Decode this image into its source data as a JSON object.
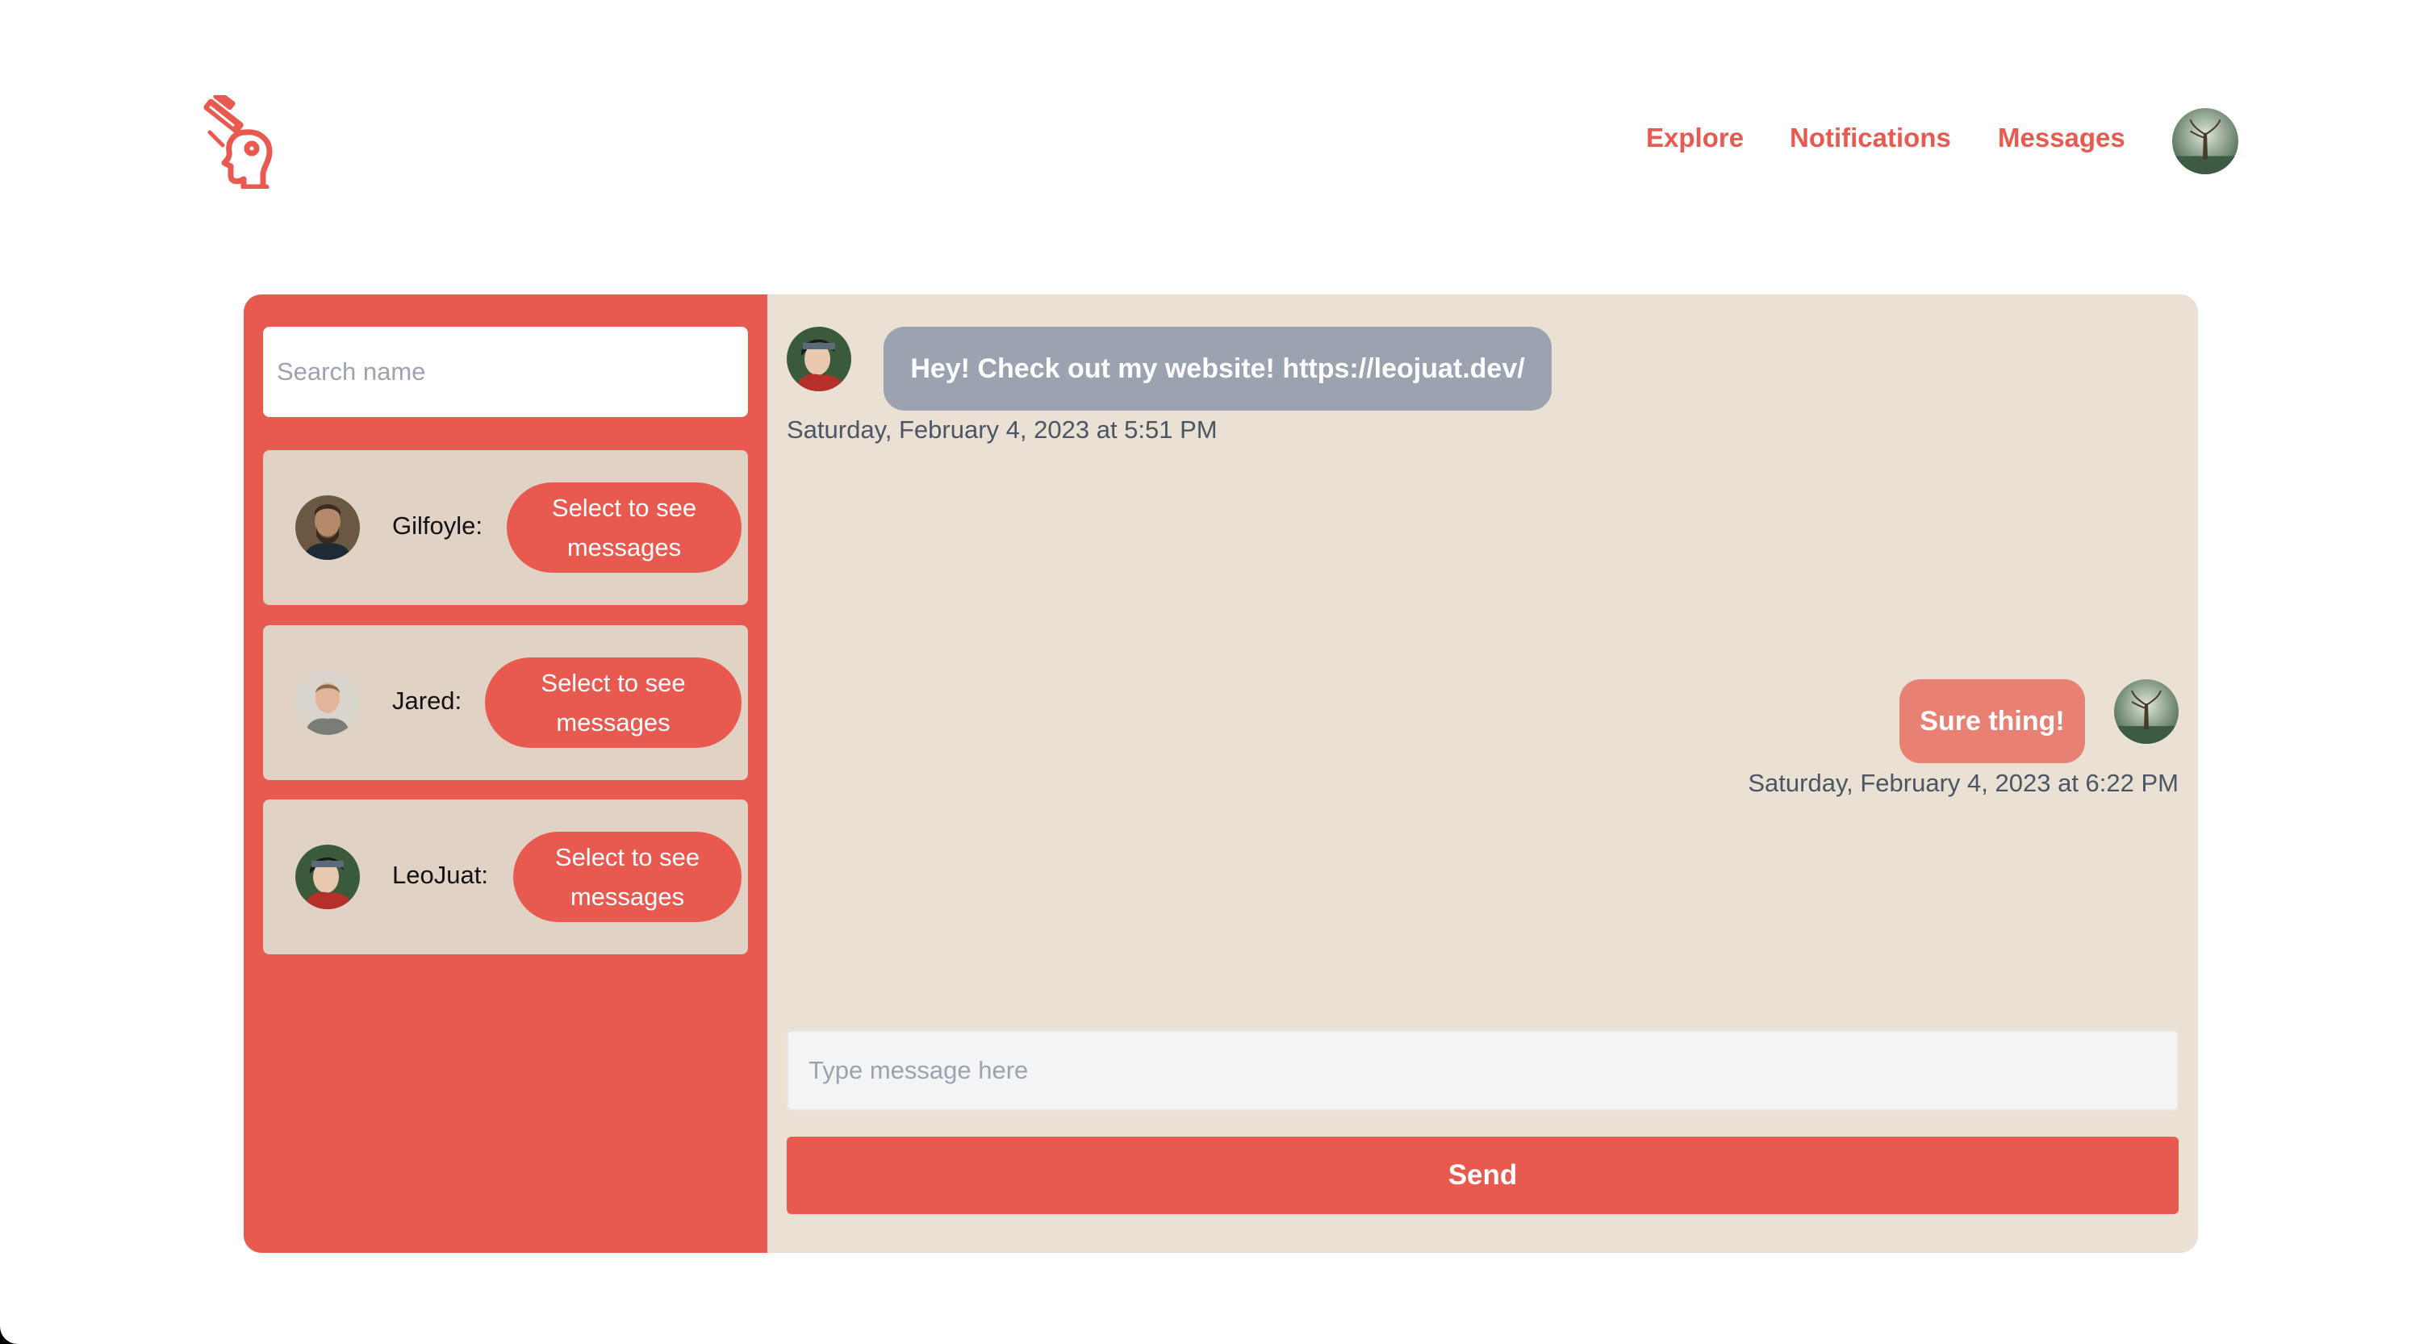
{
  "header": {
    "logo_icon": "brain-head-logo-icon",
    "nav": [
      {
        "label": "Explore"
      },
      {
        "label": "Notifications"
      },
      {
        "label": "Messages"
      }
    ],
    "profile_avatar": "user-avatar"
  },
  "colors": {
    "accent": "#e85a4f",
    "panel_background": "#eae0d4",
    "card_background": "#e0d3c6",
    "received_bubble": "#9aa3af",
    "sent_bubble": "#e98074"
  },
  "sidebar": {
    "search_placeholder": "Search name",
    "contacts": [
      {
        "name": "Gilfoyle:",
        "button_line1": "Select to see",
        "button_line2": "messages"
      },
      {
        "name": "Jared:",
        "button_line1": "Select to see",
        "button_line2": "messages"
      },
      {
        "name": "LeoJuat:",
        "button_line1": "Select to see",
        "button_line2": "messages"
      }
    ]
  },
  "chat": {
    "messages": [
      {
        "direction": "received",
        "text": "Hey! Check out my website! https://leojuat.dev/",
        "timestamp": "Saturday, February 4, 2023 at 5:51 PM"
      },
      {
        "direction": "sent",
        "text": "Sure thing!",
        "timestamp": "Saturday, February 4, 2023 at 6:22 PM"
      }
    ],
    "input_placeholder": "Type message here",
    "send_label": "Send"
  }
}
